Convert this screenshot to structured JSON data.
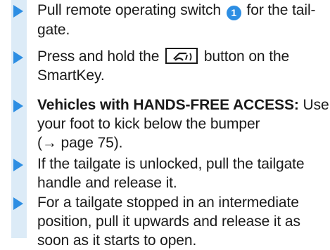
{
  "items": [
    {
      "line1_prefix": "Pull remote operating switch",
      "callout_number": "1",
      "line1_suffix": "for the tail-",
      "line2": "gate."
    },
    {
      "line1_prefix": "Press and hold the",
      "key_icon": "tailgate-key-icon",
      "line1_suffix": "button on the",
      "line2": "SmartKey."
    },
    {
      "bold_label": "Vehicles with HANDS-FREE ACCESS:",
      "line1_suffix": "Use",
      "line2": "your foot to kick below the bumper",
      "line3": "(→ page 75)."
    },
    {
      "line1": "If the tailgate is unlocked, pull the tailgate",
      "line2": "handle and release it."
    },
    {
      "line1": "For a tailgate stopped in an intermediate",
      "line2": "position, pull it upwards and release it as",
      "line3": "soon as it starts to open."
    }
  ],
  "colors": {
    "accent": "#2d8ee3",
    "stripe": "#dcebf7",
    "text": "#1a1a1a"
  }
}
